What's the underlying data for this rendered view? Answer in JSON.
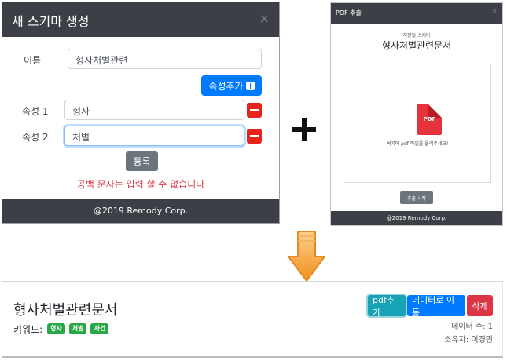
{
  "create_modal": {
    "title": "새 스키마 생성",
    "close": "×",
    "name_label": "이름",
    "name_value": "형사처벌관련",
    "add_attr_label": "속성추가",
    "attrs": [
      {
        "label": "속성 1",
        "value": "형사"
      },
      {
        "label": "속성 2",
        "value": "처벌"
      }
    ],
    "register_label": "등록",
    "error_text": "공백 문자는 입력 할 수 없습니다",
    "footer": "@2019 Remody Corp."
  },
  "pdf_modal": {
    "title": "PDF 추출",
    "close": "×",
    "saved_schema_label": "저장될 스키마",
    "schema_name": "형사처벌관련문서",
    "pdf_icon_text": "PDF",
    "drop_text": "여기에 pdf 파일을 올려주세요!",
    "extract_label": "추출 시작",
    "footer": "@2019 Remody Corp."
  },
  "result_card": {
    "title": "형사처벌관련문서",
    "keywords_label": "키워드:",
    "tags": [
      "형사",
      "처벌",
      "사건"
    ],
    "btn_pdf_add": "pdf추가",
    "btn_go_data": "데이터로 이동",
    "btn_delete": "삭제",
    "data_count": "데이터 수: 1",
    "owner": "소유자: 이경민"
  },
  "icons": {
    "plus": "plus-icon",
    "arrow": "down-arrow-icon",
    "pdf": "pdf-file-icon",
    "minus": "minus-icon"
  },
  "colors": {
    "primary": "#007bff",
    "danger": "#dc3545",
    "success": "#28a745",
    "info": "#17a2b8",
    "secondary": "#6c757d",
    "dark": "#3c4046",
    "arrow": "#f8a13c"
  }
}
